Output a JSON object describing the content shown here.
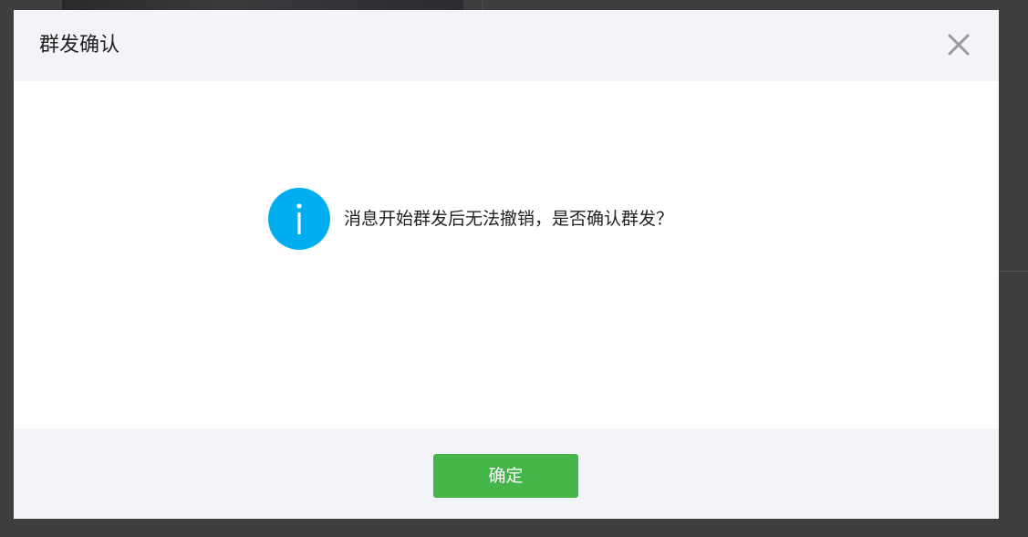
{
  "dialog": {
    "title": "群发确认",
    "message": "消息开始群发后无法撤销，是否确认群发？",
    "confirm_label": "确定"
  },
  "icons": {
    "close": "close-icon",
    "info": "info-icon"
  },
  "colors": {
    "overlay": "#3e3e3e",
    "header_bg": "#f3f4f8",
    "info_blue": "#00aeef",
    "confirm_green": "#44b549",
    "close_grey": "#9a9a9a"
  }
}
